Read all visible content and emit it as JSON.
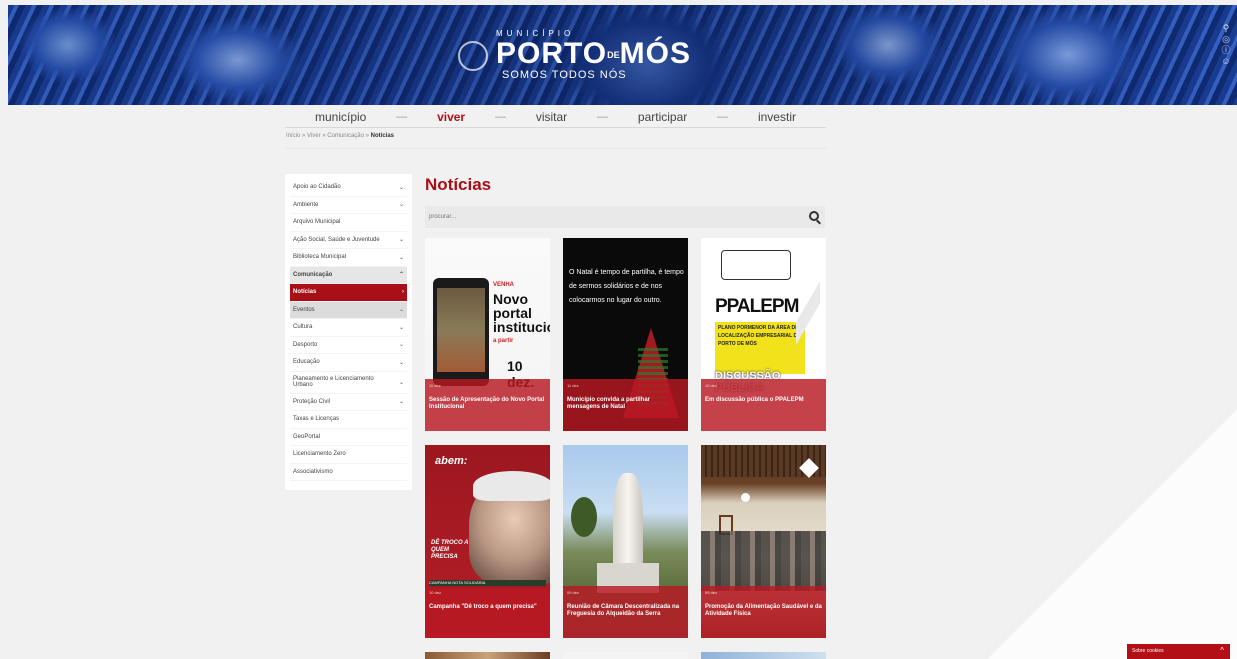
{
  "header": {
    "brand_pre": "MUNICÍPIO",
    "brand_main": "PORTO",
    "brand_de": "DE",
    "brand_main2": "MÓS",
    "brand_sub": "SOMOS TODOS NÓS",
    "side_icons": [
      "search-icon",
      "accessibility-icon",
      "info-icon",
      "user-icon"
    ]
  },
  "nav": {
    "items": [
      {
        "label": "município",
        "active": false
      },
      {
        "label": "viver",
        "active": true
      },
      {
        "label": "visitar",
        "active": false
      },
      {
        "label": "participar",
        "active": false
      },
      {
        "label": "investir",
        "active": false
      }
    ],
    "separator": "—"
  },
  "breadcrumb": {
    "items": [
      "Início",
      "Viver",
      "Comunicação"
    ],
    "sep": "»",
    "current": "Notícias"
  },
  "sidebar": {
    "items": [
      {
        "label": "Apoio ao Cidadão",
        "chev": "⌄"
      },
      {
        "label": "Ambiente",
        "chev": "⌄"
      },
      {
        "label": "Arquivo Municipal",
        "chev": ""
      },
      {
        "label": "Ação Social, Saúde e Juventude",
        "chev": "⌄"
      },
      {
        "label": "Biblioteca Municipal",
        "chev": "⌄"
      },
      {
        "label": "Comunicação",
        "chev": "⌃"
      },
      {
        "label": "Notícias",
        "chev": "›"
      },
      {
        "label": "Eventos",
        "chev": "⌄"
      },
      {
        "label": "Cultura",
        "chev": "⌄"
      },
      {
        "label": "Desporto",
        "chev": "⌄"
      },
      {
        "label": "Educação",
        "chev": "⌄"
      },
      {
        "label": "Planeamento e Licenciamento Urbano",
        "chev": "⌄"
      },
      {
        "label": "Proteção Civil",
        "chev": "⌄"
      },
      {
        "label": "Taxas e Licenças",
        "chev": ""
      },
      {
        "label": "GeoPortal",
        "chev": ""
      },
      {
        "label": "Licenciamento Zero",
        "chev": ""
      },
      {
        "label": "Associativismo",
        "chev": ""
      }
    ]
  },
  "main": {
    "title": "Notícias",
    "search_placeholder": "procurar...",
    "cards": [
      {
        "meta": "11 dez",
        "title": "Sessão de Apresentação do Novo Portal Institucional",
        "art": {
          "kicker": "VENHA",
          "line1": "Novo portal",
          "line2": "institucional",
          "small": "a partir",
          "date": "10 dez."
        }
      },
      {
        "meta": "11 dez",
        "title": "Município convida a partilhar mensagens de Natal",
        "art": {
          "text": "O Natal é tempo de partilha, é tempo de sermos solidários e de nos colocarmos no lugar do outro."
        }
      },
      {
        "meta": "10 dez",
        "title": "Em discussão pública o PPALEPM",
        "art": {
          "big": "PPALEPM",
          "yellow": "PLANO PORMENOR DA ÁREA DE LOCALIZAÇÃO EMPRESARIAL DE PORTO DE MÓS",
          "disc": "DISCUSSÃO PÚBLICA"
        }
      },
      {
        "meta": "10 dez",
        "title": "Campanha \"Dê troco a quem precisa\"",
        "art": {
          "logo": "abem:",
          "tag": "DÊ TROCO A QUEM PRECISA",
          "strip": "CAMPANHA NOTA SOLIDÁRIA"
        }
      },
      {
        "meta": "09 dez",
        "title": "Reunião de Câmara Descentralizada na Freguesia do Alqueidão da Serra",
        "art": {}
      },
      {
        "meta": "09 dez",
        "title": "Promoção da Alimentação Saudável e da Atividade Física",
        "art": {}
      }
    ]
  },
  "cookie": {
    "label": "Sobre cookies",
    "chev": "^"
  },
  "colors": {
    "accent": "#b30f16",
    "banner": "#1b3f98",
    "background": "#f1f1f1"
  }
}
